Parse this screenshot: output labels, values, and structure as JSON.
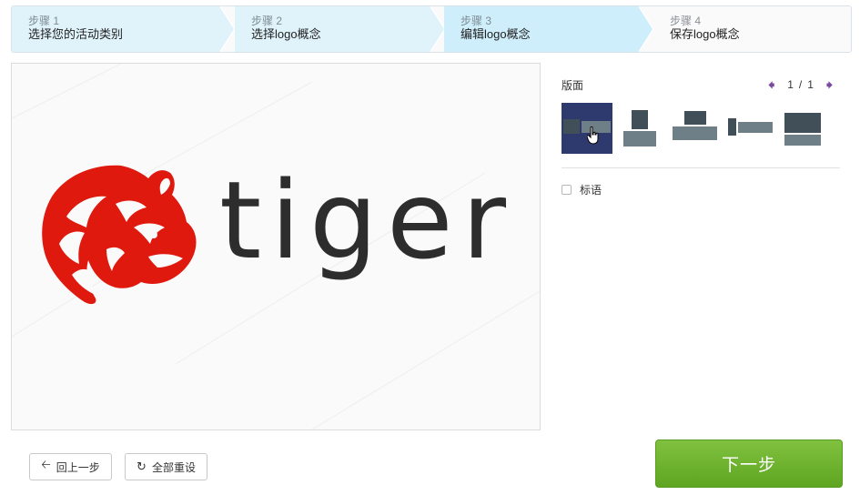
{
  "steps": [
    {
      "num": "步骤 1",
      "label": "选择您的活动类别"
    },
    {
      "num": "步骤 2",
      "label": "选择logo概念"
    },
    {
      "num": "步骤 3",
      "label": "编辑logo概念"
    },
    {
      "num": "步骤 4",
      "label": "保存logo概念"
    }
  ],
  "canvas": {
    "logo_text": "tiger",
    "logo_icon": "tiger-head-icon",
    "logo_color": "#e0190f",
    "text_color": "#2d2d2d"
  },
  "panel": {
    "title": "版面",
    "pager": {
      "current": "1",
      "separator": "/",
      "total": "1",
      "prev_icon": "arrow-left-icon",
      "next_icon": "arrow-right-icon"
    },
    "layout_options": [
      {
        "name": "icon-left-text-right",
        "selected": true
      },
      {
        "name": "icon-top-text-bottom",
        "selected": false
      },
      {
        "name": "icon-top-wide-text-bottom",
        "selected": false
      },
      {
        "name": "icon-left-small-text-right",
        "selected": false
      },
      {
        "name": "stacked-wide",
        "selected": false
      }
    ],
    "slogan_label": "标语",
    "slogan_checked": false
  },
  "buttons": {
    "back": "回上一步",
    "back_icon": "arrow-left-icon",
    "reset": "全部重设",
    "reset_icon": "refresh-icon",
    "next": "下一步"
  },
  "colors": {
    "step_active_bg": "#cfeefb",
    "step_done_bg": "#e0f3fb",
    "selected_layout": "#2e3a6e",
    "pager_arrow": "#7a4aa0",
    "next_button": "#6cb22e"
  }
}
